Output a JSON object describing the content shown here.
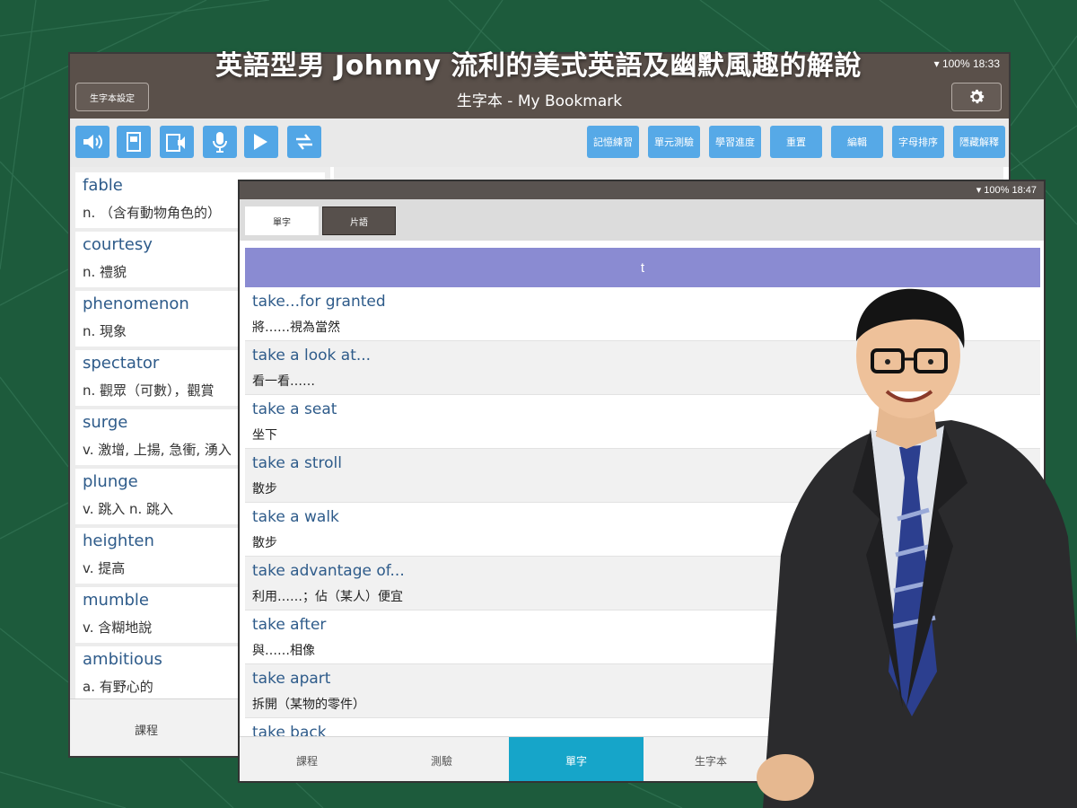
{
  "headline": "英語型男 Johnny 流利的美式英語及幽默風趣的解說",
  "back_tablet": {
    "status": "100% 18:33",
    "title": "生字本 - My Bookmark",
    "settings_button": "生字本設定",
    "toolbar_icons": [
      "speaker-icon",
      "flashcard-icon",
      "flashcard-audio-icon",
      "microphone-icon",
      "play-all-icon",
      "repeat-icon"
    ],
    "toolbar_buttons": [
      "記憶練習",
      "單元測驗",
      "學習進度",
      "重置",
      "編輯",
      "字母排序",
      "隱藏解釋"
    ],
    "words": [
      {
        "word": "fable",
        "def": "n. （含有動物角色的）"
      },
      {
        "word": "courtesy",
        "def": "n. 禮貌"
      },
      {
        "word": "phenomenon",
        "def": "n. 現象"
      },
      {
        "word": "spectator",
        "def": "n. 觀眾（可數），觀賞"
      },
      {
        "word": "surge",
        "def": "v. 激增, 上揚, 急衝, 湧入"
      },
      {
        "word": "plunge",
        "def": "v. 跳入  n. 跳入"
      },
      {
        "word": "heighten",
        "def": "v. 提高"
      },
      {
        "word": "mumble",
        "def": "v. 含糊地說"
      },
      {
        "word": "ambitious",
        "def": "a. 有野心的"
      }
    ],
    "bottom_label": "課程"
  },
  "front_tablet": {
    "status": "100% 18:47",
    "tabs": [
      "單字",
      "片語"
    ],
    "section_header": "t",
    "rows": [
      {
        "word": "take...for granted",
        "def": "將……視為當然"
      },
      {
        "word": "take a look at...",
        "def": "看一看……"
      },
      {
        "word": "take a seat",
        "def": "坐下"
      },
      {
        "word": "take a stroll",
        "def": "散步"
      },
      {
        "word": "take a walk",
        "def": "散步"
      },
      {
        "word": "take advantage of...",
        "def": "利用……；佔（某人）便宜"
      },
      {
        "word": "take after",
        "def": "與……相像"
      },
      {
        "word": "take apart",
        "def": "拆開（某物的零件）"
      },
      {
        "word": "take back",
        "def": ""
      }
    ],
    "nav": [
      "課程",
      "測驗",
      "單字",
      "生字本"
    ],
    "active_nav_index": 2
  },
  "colors": {
    "background_green": "#1d5b3c",
    "header_brown": "#5a504a",
    "toolbar_blue": "#52a6e6",
    "section_purple": "#8a8bd2",
    "nav_active": "#16a5c9",
    "word_blue": "#2e5b8a"
  }
}
